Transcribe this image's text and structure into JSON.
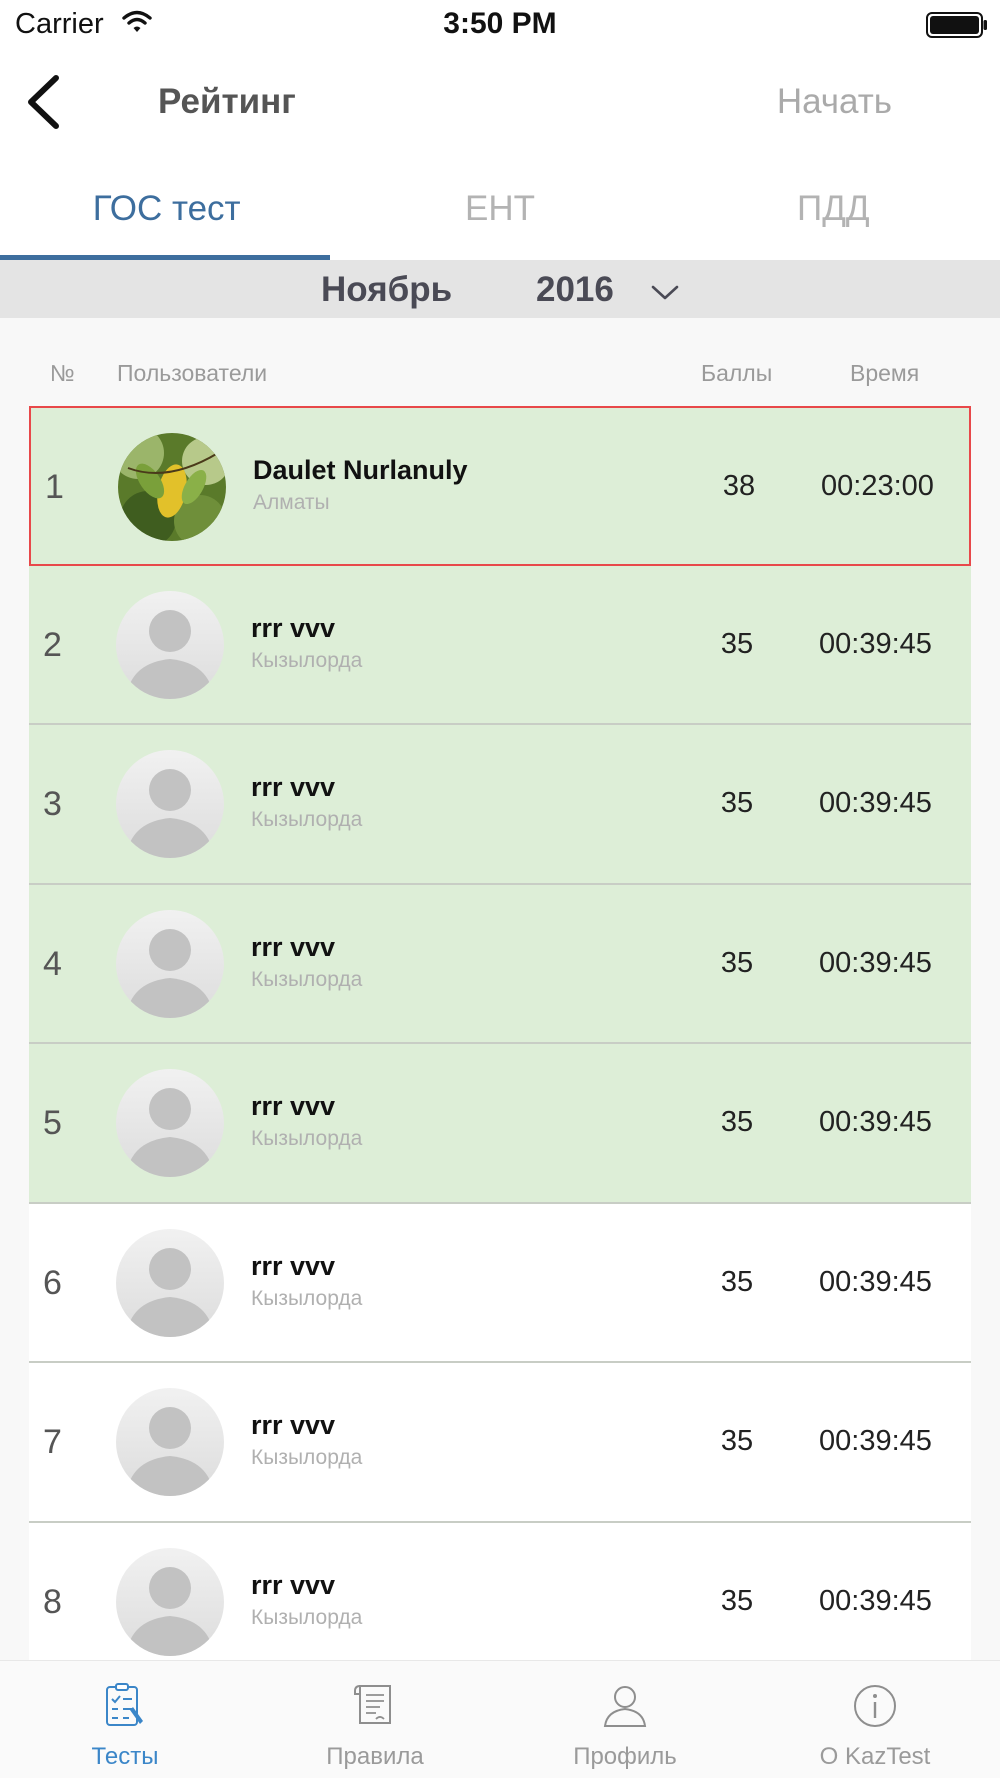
{
  "status_bar": {
    "carrier": "Carrier",
    "time": "3:50 PM"
  },
  "nav": {
    "title": "Рейтинг",
    "action": "Начать"
  },
  "tabs": [
    {
      "label": "ГОС тест",
      "active": true
    },
    {
      "label": "ЕНТ",
      "active": false
    },
    {
      "label": "ПДД",
      "active": false
    }
  ],
  "period": {
    "month": "Ноябрь",
    "year": "2016"
  },
  "table_header": {
    "num": "№",
    "users": "Пользователи",
    "score": "Баллы",
    "time": "Время"
  },
  "rows": [
    {
      "rank": "1",
      "name": "Daulet Nurlanuly",
      "city": "Алматы",
      "score": "38",
      "time": "00:23:00",
      "avatar": "photo",
      "highlight": true,
      "selected": true
    },
    {
      "rank": "2",
      "name": "rrr vvv",
      "city": "Кызылорда",
      "score": "35",
      "time": "00:39:45",
      "avatar": "placeholder",
      "highlight": true,
      "selected": false
    },
    {
      "rank": "3",
      "name": "rrr vvv",
      "city": "Кызылорда",
      "score": "35",
      "time": "00:39:45",
      "avatar": "placeholder",
      "highlight": true,
      "selected": false
    },
    {
      "rank": "4",
      "name": "rrr vvv",
      "city": "Кызылорда",
      "score": "35",
      "time": "00:39:45",
      "avatar": "placeholder",
      "highlight": true,
      "selected": false
    },
    {
      "rank": "5",
      "name": "rrr vvv",
      "city": "Кызылорда",
      "score": "35",
      "time": "00:39:45",
      "avatar": "placeholder",
      "highlight": true,
      "selected": false
    },
    {
      "rank": "6",
      "name": "rrr vvv",
      "city": "Кызылорда",
      "score": "35",
      "time": "00:39:45",
      "avatar": "placeholder",
      "highlight": false,
      "selected": false
    },
    {
      "rank": "7",
      "name": "rrr vvv",
      "city": "Кызылорда",
      "score": "35",
      "time": "00:39:45",
      "avatar": "placeholder",
      "highlight": false,
      "selected": false
    },
    {
      "rank": "8",
      "name": "rrr vvv",
      "city": "Кызылорда",
      "score": "35",
      "time": "00:39:45",
      "avatar": "placeholder",
      "highlight": false,
      "selected": false
    }
  ],
  "tab_bar": [
    {
      "label": "Тесты",
      "icon": "tests-icon",
      "active": true
    },
    {
      "label": "Правила",
      "icon": "rules-icon",
      "active": false
    },
    {
      "label": "Профиль",
      "icon": "profile-icon",
      "active": false
    },
    {
      "label": "О KazTest",
      "icon": "info-icon",
      "active": false
    }
  ],
  "colors": {
    "accent": "#3d6e9e",
    "tab_bar_active": "#3b86c8",
    "highlight_row": "#ddeed7",
    "selected_border": "#e8484a"
  }
}
